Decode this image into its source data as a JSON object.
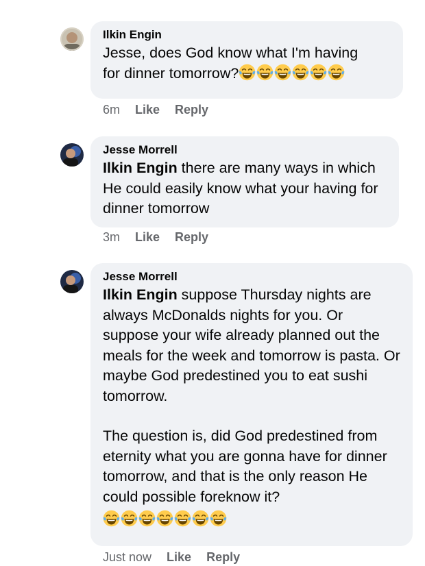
{
  "comments": [
    {
      "author": "Ilkin Engin",
      "text_lines": [
        "Jesse, does God know what I'm having",
        "for dinner tomorrow?"
      ],
      "emoji_count": 6,
      "emoji_icon": "tears-of-joy-icon",
      "time": "6m",
      "like_label": "Like",
      "reply_label": "Reply"
    },
    {
      "author": "Jesse Morrell",
      "tag": "Ilkin Engin",
      "text": " there are many ways in which He could easily know what your having for dinner tomorrow",
      "time": "3m",
      "like_label": "Like",
      "reply_label": "Reply"
    },
    {
      "author": "Jesse Morrell",
      "tag": "Ilkin Engin",
      "text_p1": " suppose Thursday nights are always McDonalds nights for you. Or suppose your wife already planned out the meals for the week and tomorrow is pasta. Or maybe God predestined you to eat sushi tomorrow.",
      "text_p2": "The question is, did God predestined from eternity what you are gonna have for dinner tomorrow, and that is the only reason He could possible foreknow it?",
      "emoji_count": 7,
      "emoji_icon": "tears-of-joy-icon",
      "time": "Just now",
      "like_label": "Like",
      "reply_label": "Reply"
    }
  ],
  "colors": {
    "bubble": "#f0f2f5",
    "meta_text": "#65676b",
    "emoji_face": "#ffcc4d",
    "emoji_tear": "#5dadec"
  }
}
